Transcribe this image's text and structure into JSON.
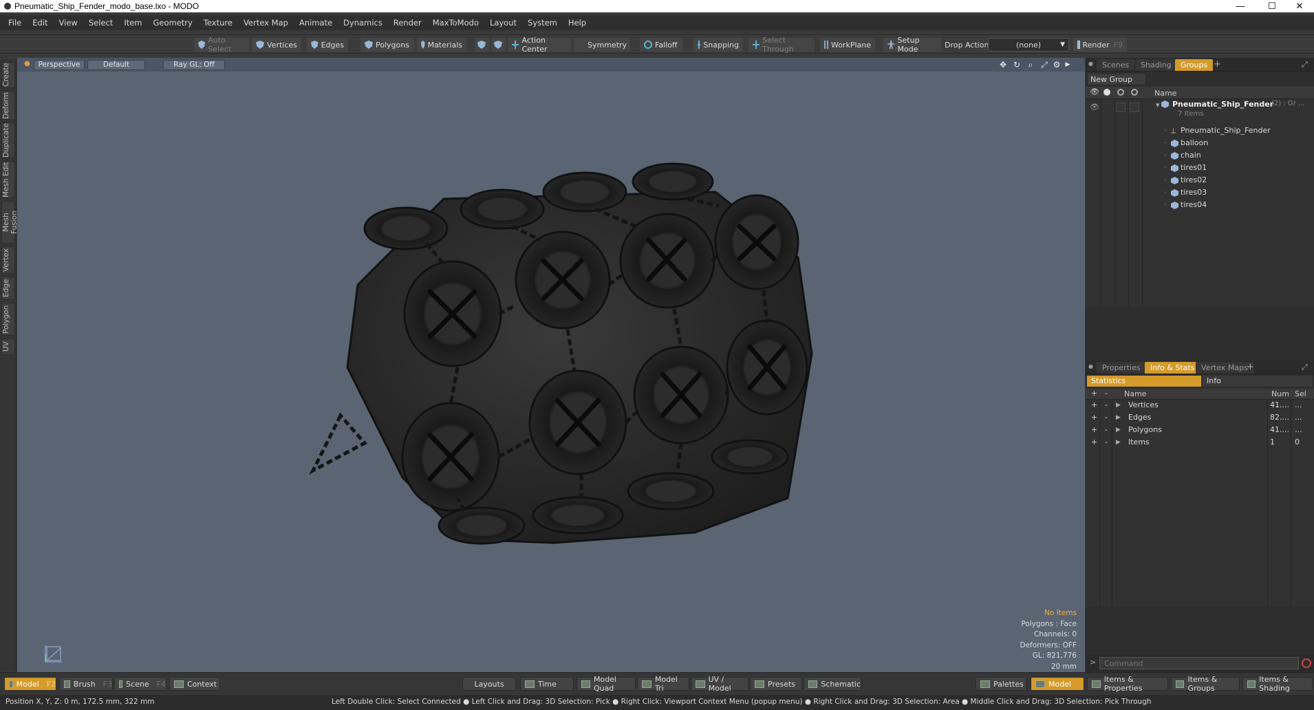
{
  "window": {
    "title": "Pneumatic_Ship_Fender_modo_base.lxo - MODO",
    "controls": [
      "—",
      "☐",
      "✕"
    ]
  },
  "menu": [
    "File",
    "Edit",
    "View",
    "Select",
    "Item",
    "Geometry",
    "Texture",
    "Vertex Map",
    "Animate",
    "Dynamics",
    "Render",
    "MaxToModo",
    "Layout",
    "System",
    "Help"
  ],
  "toolbar": {
    "auto_select": "Auto Select",
    "vertices": "Vertices",
    "edges": "Edges",
    "polygons": "Polygons",
    "materials": "Materials",
    "action_center": "Action Center",
    "symmetry": "Symmetry",
    "falloff": "Falloff",
    "snapping": "Snapping",
    "select_through": "Select Through",
    "workplane": "WorkPlane",
    "setup_mode": "Setup Mode",
    "drop_action_label": "Drop Action",
    "drop_action_value": "(none)",
    "render": "Render",
    "render_key": "F9"
  },
  "side_tabs": [
    "Create",
    "Deform",
    "Duplicate",
    "Mesh Edit",
    "Mesh Fusion",
    "Vertex",
    "Edge",
    "Polygon",
    "UV"
  ],
  "viewport": {
    "view": "Perspective",
    "shading": "Default",
    "raygl": "Ray GL: Off",
    "info": {
      "selection": "No Items",
      "polygons": "Polygons : Face",
      "channels": "Channels: 0",
      "deformers": "Deformers: OFF",
      "gl": "GL: 821,776",
      "scale": "20 mm"
    }
  },
  "groups_panel": {
    "tabs": [
      "Scenes",
      "Shading",
      "Groups"
    ],
    "active_tab": "Groups",
    "new_group": "New Group",
    "name_header": "Name",
    "root": {
      "name": "Pneumatic_Ship_Fender",
      "suffix": "(2) : Gr ...",
      "count": "7 Items"
    },
    "items": [
      "Pneumatic_Ship_Fender",
      "balloon",
      "chain",
      "tires01",
      "tires02",
      "tires03",
      "tires04"
    ]
  },
  "props_panel": {
    "tabs": [
      "Properties",
      "Info & Stats",
      "Vertex Maps"
    ],
    "active_tab": "Info & Stats",
    "sub_tabs": [
      "Statistics",
      "Info"
    ],
    "headers": {
      "name": "Name",
      "num": "Num",
      "sel": "Sel"
    },
    "rows": [
      {
        "name": "Vertices",
        "num": "41....",
        "sel": "..."
      },
      {
        "name": "Edges",
        "num": "82....",
        "sel": "..."
      },
      {
        "name": "Polygons",
        "num": "41....",
        "sel": "..."
      },
      {
        "name": "Items",
        "num": "1",
        "sel": "0"
      }
    ]
  },
  "command_placeholder": "Command",
  "bottom_bar": {
    "model": "Model",
    "model_key": "F2",
    "brush": "Brush",
    "brush_key": "F3",
    "scene": "Scene",
    "scene_key": "F4",
    "context": "Context",
    "layouts": "Layouts",
    "time": "Time",
    "model_quad": "Model Quad",
    "model_tri": "Model Tri",
    "uv_model": "UV / Model",
    "presets": "Presets",
    "schematic": "Schematic",
    "palettes": "Palettes",
    "model_right": "Model",
    "items_props": "Items & Properties",
    "items_groups": "Items & Groups",
    "items_shading": "Items & Shading"
  },
  "footer": {
    "position": "Position X, Y, Z:   0 m, 172.5 mm, 322 mm",
    "hints": "Left Double Click: Select Connected ● Left Click and Drag: 3D Selection: Pick ● Right Click: Viewport Context Menu (popup menu) ● Right Click and Drag: 3D Selection: Area ● Middle Click and Drag: 3D Selection: Pick Through"
  },
  "colors": {
    "accent": "#d49a2a",
    "viewport_bg": "#5a6473",
    "highlight_text": "#f0b040"
  }
}
